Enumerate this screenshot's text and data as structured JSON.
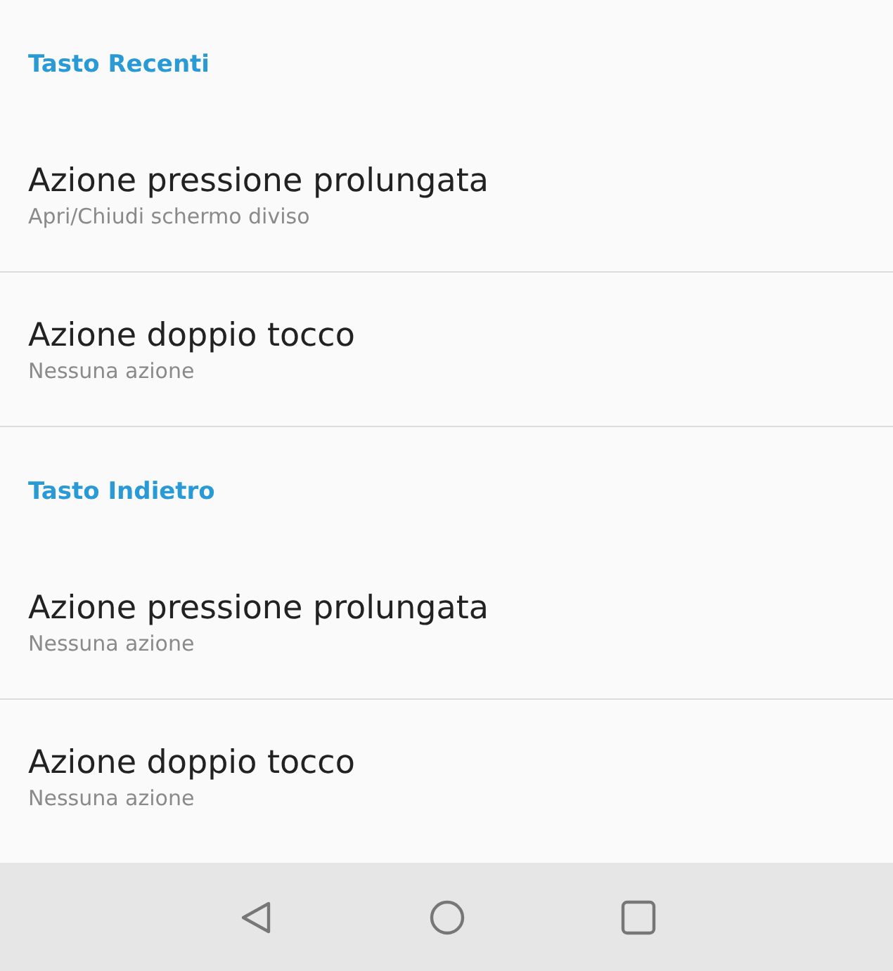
{
  "sections": [
    {
      "header": "Tasto Recenti",
      "items": [
        {
          "title": "Azione pressione prolungata",
          "subtitle": "Apri/Chiudi schermo diviso"
        },
        {
          "title": "Azione doppio tocco",
          "subtitle": "Nessuna azione"
        }
      ]
    },
    {
      "header": "Tasto Indietro",
      "items": [
        {
          "title": "Azione pressione prolungata",
          "subtitle": "Nessuna azione"
        },
        {
          "title": "Azione doppio tocco",
          "subtitle": "Nessuna azione"
        }
      ]
    }
  ]
}
